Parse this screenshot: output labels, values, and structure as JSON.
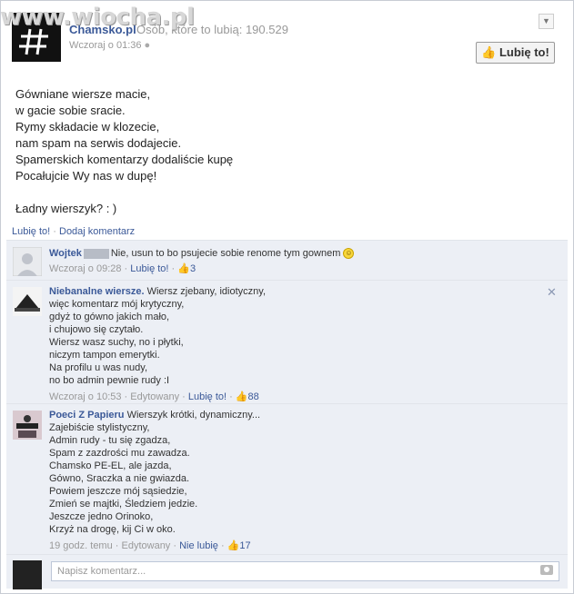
{
  "watermark": "www.wiocha.pl",
  "post": {
    "page_name": "Chamsko.pl",
    "likes_text": "Osób, które to lubią: 190.529",
    "time": "Wczoraj o 01:36",
    "like_button": "Lubię to!",
    "poem_lines": [
      "Gówniane wiersze macie,",
      "w gacie sobie sracie.",
      "Rymy składacie w klozecie,",
      "nam spam na serwis dodajecie.",
      "Spamerskich komentarzy dodaliście kupę",
      "Pocałujcie Wy nas w dupę!",
      "",
      "Ładny wierszyk? : )"
    ],
    "actions": {
      "like": "Lubię to!",
      "comment": "Dodaj komentarz"
    }
  },
  "comments": [
    {
      "author": "Wojtek",
      "lines": [
        "Nie, usun to bo psujecie sobie renome tym gownem"
      ],
      "time": "Wczoraj o 09:28",
      "edited": "",
      "like_label": "Lubię to!",
      "likes": "3"
    },
    {
      "author": "Niebanalne wiersze.",
      "lines": [
        "Wiersz zjebany, idiotyczny,",
        "więc komentarz mój krytyczny,",
        "gdyż to gówno jakich mało,",
        "i chujowo się czytało.",
        "Wiersz wasz suchy, no i płytki,",
        "niczym tampon emerytki.",
        "Na profilu u was nudy,",
        "no bo admin pewnie rudy :I"
      ],
      "time": "Wczoraj o 10:53",
      "edited": "Edytowany",
      "like_label": "Lubię to!",
      "likes": "88"
    },
    {
      "author": "Poeci Z Papieru",
      "lines": [
        "Wierszyk krótki, dynamiczny...",
        "Zajebiście stylistyczny,",
        "Admin rudy - tu się zgadza,",
        "Spam z zazdrości mu zawadza.",
        "Chamsko PE-EL, ale jazda,",
        "Gówno, Sraczka a nie gwiazda.",
        "Powiem jeszcze mój sąsiedzie,",
        "Zmień se majtki, Śledziem jedzie.",
        "Jeszcze jedno Orinoko,",
        "Krzyż na drogę, kij Ci w oko."
      ],
      "time": "19 godz. temu",
      "edited": "Edytowany",
      "like_label": "Nie lubię",
      "likes": "17"
    }
  ],
  "write_comment": {
    "placeholder": "Napisz komentarz..."
  },
  "icons": {
    "globe": "globe-icon",
    "thumb": "thumbs-up-icon",
    "camera": "camera-icon",
    "close": "close-icon",
    "chevron": "chevron-down-icon"
  },
  "colors": {
    "link": "#3b5998",
    "comment_bg": "#eceff5",
    "muted": "#999999"
  }
}
